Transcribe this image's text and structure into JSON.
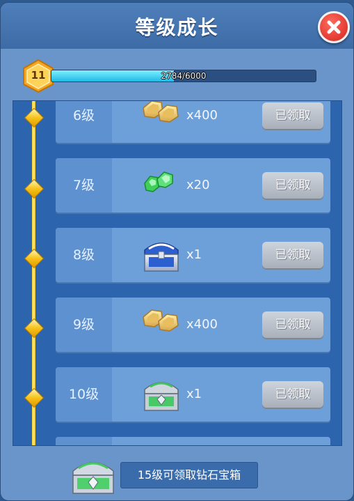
{
  "header": {
    "title": "等级成长"
  },
  "player": {
    "level": "11",
    "xp_text": "2784/6000",
    "xp_progress": 0.464
  },
  "rows": [
    {
      "level": "6级",
      "reward": "coins-icon",
      "qty": "x400",
      "button": "已领取"
    },
    {
      "level": "7级",
      "reward": "gems-icon",
      "qty": "x20",
      "button": "已领取"
    },
    {
      "level": "8级",
      "reward": "blue-chest-icon",
      "qty": "x1",
      "button": "已领取"
    },
    {
      "level": "9级",
      "reward": "coins-icon",
      "qty": "x400",
      "button": "已领取"
    },
    {
      "level": "10级",
      "reward": "green-chest-icon",
      "qty": "x1",
      "button": "已领取"
    }
  ],
  "footer": {
    "label": "15级可领取钻石宝箱",
    "reward": "diamond-chest-icon"
  },
  "colors": {
    "accent": "#1fb9e6",
    "timeline": "#f6d23a",
    "close": "#d6231d"
  }
}
